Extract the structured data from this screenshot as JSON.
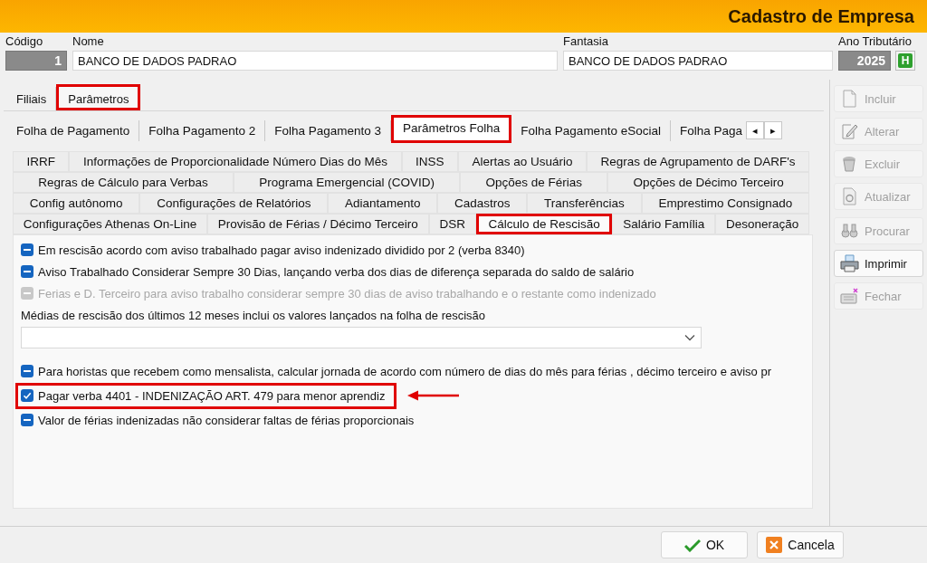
{
  "window": {
    "title": "Cadastro de Empresa"
  },
  "header": {
    "fields": [
      {
        "kind": "code",
        "label": "Código",
        "value": "1"
      },
      {
        "kind": "text",
        "label": "Nome",
        "value": "BANCO DE DADOS PADRAO"
      },
      {
        "kind": "text",
        "label": "Fantasia",
        "value": "BANCO DE DADOS PADRAO"
      },
      {
        "kind": "year",
        "label": "Ano Tributário",
        "value": "2025",
        "button": "H"
      }
    ]
  },
  "tabs": [
    {
      "label": "Filiais",
      "selected": false,
      "highlighted": false
    },
    {
      "label": "Parâmetros",
      "selected": true,
      "highlighted": true
    }
  ],
  "sub_tabs": {
    "items": [
      {
        "label": "Folha de Pagamento",
        "selected": false,
        "highlighted": false
      },
      {
        "label": "Folha Pagamento 2",
        "selected": false,
        "highlighted": false
      },
      {
        "label": "Folha Pagamento 3",
        "selected": false,
        "highlighted": false
      },
      {
        "label": "Parâmetros Folha",
        "selected": true,
        "highlighted": true
      },
      {
        "label": "Folha Pagamento eSocial",
        "selected": false,
        "highlighted": false
      },
      {
        "label": "Folha Paga",
        "selected": false,
        "highlighted": false
      }
    ],
    "scroll_buttons": [
      "◂",
      "▸"
    ]
  },
  "section_tabs": {
    "rows": [
      {
        "tabs": [
          {
            "label": "IRRF",
            "selected": false,
            "highlighted": false
          },
          {
            "label": "Informações de Proporcionalidade Número Dias do Mês",
            "selected": false,
            "highlighted": false
          },
          {
            "label": "INSS",
            "selected": false,
            "highlighted": false
          },
          {
            "label": "Alertas ao Usuário",
            "selected": false,
            "highlighted": false
          },
          {
            "label": "Regras de Agrupamento de DARF's",
            "selected": false,
            "highlighted": false
          }
        ]
      },
      {
        "tabs": [
          {
            "label": "Regras de Cálculo para Verbas",
            "selected": false,
            "highlighted": false
          },
          {
            "label": "Programa Emergencial (COVID)",
            "selected": false,
            "highlighted": false
          },
          {
            "label": "Opções de Férias",
            "selected": false,
            "highlighted": false
          },
          {
            "label": "Opções de Décimo Terceiro",
            "selected": false,
            "highlighted": false
          }
        ]
      },
      {
        "tabs": [
          {
            "label": "Config autônomo",
            "selected": false,
            "highlighted": false
          },
          {
            "label": "Configurações de Relatórios",
            "selected": false,
            "highlighted": false
          },
          {
            "label": "Adiantamento",
            "selected": false,
            "highlighted": false
          },
          {
            "label": "Cadastros",
            "selected": false,
            "highlighted": false
          },
          {
            "label": "Transferências",
            "selected": false,
            "highlighted": false
          },
          {
            "label": "Emprestimo Consignado",
            "selected": false,
            "highlighted": false
          }
        ]
      },
      {
        "tabs": [
          {
            "label": "Configurações Athenas On-Line",
            "selected": false,
            "highlighted": false
          },
          {
            "label": "Provisão de Férias / Décimo Terceiro",
            "selected": false,
            "highlighted": false
          },
          {
            "label": "DSR",
            "selected": false,
            "highlighted": false
          },
          {
            "label": "Cálculo de Rescisão",
            "selected": true,
            "highlighted": true
          },
          {
            "label": "Salário Família",
            "selected": false,
            "highlighted": false
          },
          {
            "label": "Desoneração",
            "selected": false,
            "highlighted": false
          }
        ]
      }
    ]
  },
  "options": [
    {
      "kind": "checkbox",
      "label": "Em rescisão acordo com aviso trabalhado pagar aviso indenizado dividido por 2 (verba 8340)",
      "checked": true,
      "indeterminate": true,
      "disabled": false
    },
    {
      "kind": "checkbox",
      "label": "Aviso Trabalhado Considerar Sempre 30 Dias, lançando verba dos dias de diferença separada do saldo de salário",
      "checked": true,
      "indeterminate": true,
      "disabled": false
    },
    {
      "kind": "checkbox",
      "label": "Ferias e D. Terceiro para aviso trabalho considerar sempre 30 dias de aviso trabalhando e o restante como indenizado",
      "checked": true,
      "indeterminate": true,
      "disabled": true
    },
    {
      "kind": "label",
      "label": "Médias de rescisão dos últimos 12 meses inclui os valores lançados na folha de rescisão"
    },
    {
      "kind": "dropdown"
    },
    {
      "kind": "checkbox",
      "label": "Para horistas que recebem como mensalista, calcular jornada de acordo com número de dias do mês para férias , décimo terceiro e aviso pr",
      "checked": true,
      "indeterminate": true,
      "disabled": false
    },
    {
      "kind": "checkbox",
      "label": "Pagar verba 4401 - INDENIZAÇÃO ART. 479 para menor aprendiz",
      "checked": true,
      "disabled": false,
      "highlighted": true,
      "arrow": true
    },
    {
      "kind": "checkbox",
      "label": "Valor de férias indenizadas não considerar faltas de férias proporcionais",
      "checked": true,
      "indeterminate": true,
      "disabled": false
    }
  ],
  "side_buttons": [
    {
      "kind": "include",
      "label": "Incluir",
      "disabled": true
    },
    {
      "kind": "edit",
      "label": "Alterar",
      "disabled": true
    },
    {
      "kind": "delete",
      "label": "Excluir",
      "disabled": true
    },
    {
      "kind": "refresh",
      "label": "Atualizar",
      "disabled": true
    },
    {
      "kind": "search",
      "label": "Procurar",
      "disabled": true
    },
    {
      "kind": "print",
      "label": "Imprimir",
      "disabled": false
    },
    {
      "kind": "close",
      "label": "Fechar",
      "disabled": true
    }
  ],
  "footer_buttons": [
    {
      "kind": "ok",
      "label": "OK"
    },
    {
      "kind": "cancel",
      "label": "Cancela"
    }
  ]
}
